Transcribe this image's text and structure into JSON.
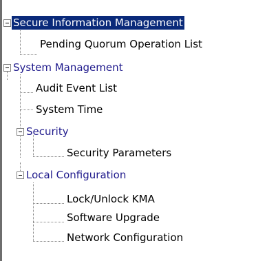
{
  "tree": {
    "nodes": [
      {
        "label": "Secure Information Management",
        "type": "folder",
        "expanded": true,
        "selected": true
      },
      {
        "label": "Pending Quorum Operation List",
        "type": "leaf"
      },
      {
        "label": "System Management",
        "type": "folder",
        "expanded": true
      },
      {
        "label": "Audit Event List",
        "type": "leaf"
      },
      {
        "label": "System Time",
        "type": "leaf"
      },
      {
        "label": "Security",
        "type": "folder",
        "expanded": true
      },
      {
        "label": "Security Parameters",
        "type": "leaf"
      },
      {
        "label": "Local Configuration",
        "type": "folder",
        "expanded": true
      },
      {
        "label": "Lock/Unlock KMA",
        "type": "leaf"
      },
      {
        "label": "Software Upgrade",
        "type": "leaf"
      },
      {
        "label": "Network Configuration",
        "type": "leaf"
      }
    ]
  },
  "colors": {
    "folder_text": "#1f1a8c",
    "leaf_text": "#000000",
    "selection_background": "#0a2a7a",
    "selection_text": "#ffffff",
    "connector_lines": "#808080"
  },
  "icons": {
    "expander": "minus-box-icon"
  }
}
